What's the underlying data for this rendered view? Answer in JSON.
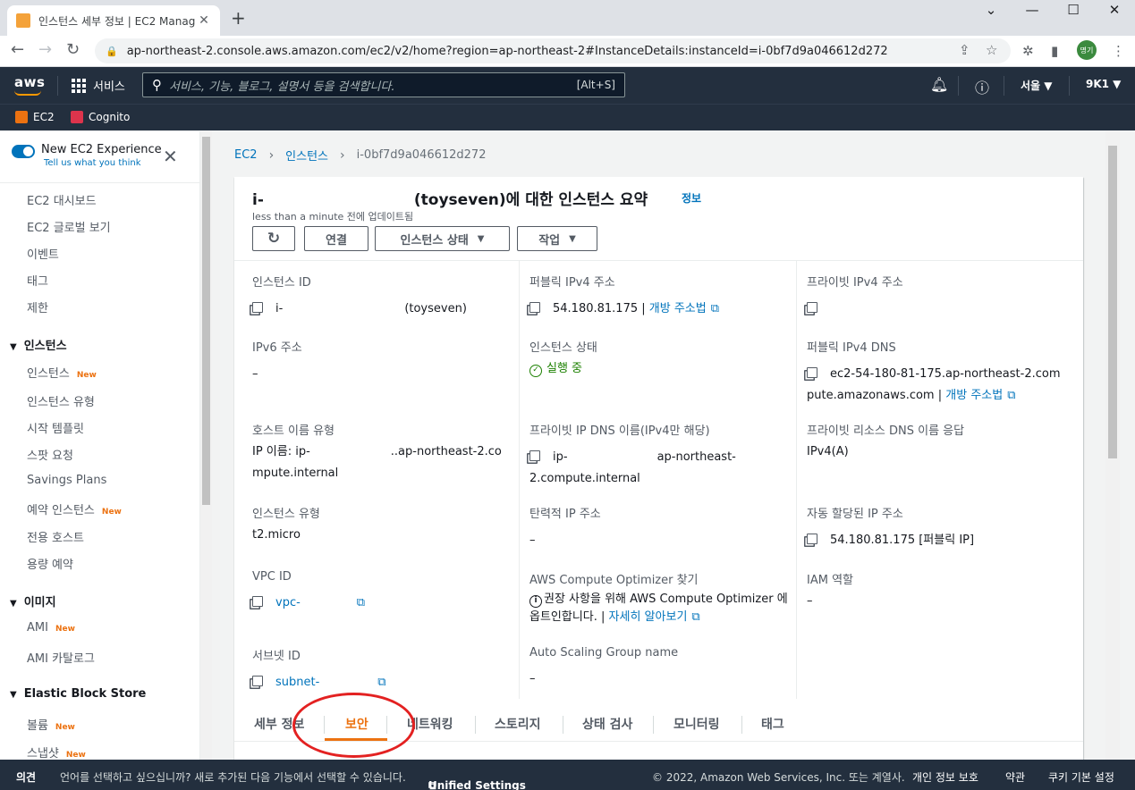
{
  "browser": {
    "tab_title": "인스턴스 세부 정보 | EC2 Manag",
    "url": "ap-northeast-2.console.aws.amazon.com/ec2/v2/home?region=ap-northeast-2#InstanceDetails:instanceId=i-0bf7d9a046612d272",
    "profile_initials": "명기"
  },
  "header": {
    "logo": "aws",
    "services_label": "서비스",
    "search_placeholder": "서비스, 기능, 블로그, 설명서 등을 검색합니다.",
    "search_shortcut": "[Alt+S]",
    "region": "서울 ▼",
    "account": "9K1 ▼"
  },
  "favorites": [
    {
      "label": "EC2",
      "color": "#ec7211"
    },
    {
      "label": "Cognito",
      "color": "#dd344c"
    }
  ],
  "sidebar": {
    "new_experience": "New EC2 Experience",
    "feedback": "Tell us what you think",
    "top_items": [
      "EC2 대시보드",
      "EC2 글로벌 보기",
      "이벤트",
      "태그",
      "제한"
    ],
    "sections": {
      "instances": "인스턴스",
      "images": "이미지",
      "ebs": "Elastic Block Store"
    },
    "instance_items": [
      "인스턴스",
      "인스턴스 유형",
      "시작 템플릿",
      "스팟 요청",
      "Savings Plans",
      "예약 인스턴스",
      "전용 호스트",
      "용량 예약"
    ],
    "image_items": [
      "AMI",
      "AMI 카탈로그"
    ],
    "ebs_items": [
      "볼륨",
      "스냅샷"
    ],
    "new_badge": "New"
  },
  "breadcrumb": [
    "EC2",
    "인스턴스",
    "i-0bf7d9a046612d272"
  ],
  "summary": {
    "title_prefix": "i-",
    "title_suffix": "(toyseven)에 대한 인스턴스 요약",
    "info": "정보",
    "updated": "less than a minute 전에 업데이트됨",
    "buttons": {
      "connect": "연결",
      "state": "인스턴스 상태",
      "actions": "작업"
    }
  },
  "details": {
    "instance_id_label": "인스턴스 ID",
    "instance_id_value": "i-",
    "instance_id_name": "(toyseven)",
    "public_ipv4_label": "퍼블릭 IPv4 주소",
    "public_ipv4_value": "54.180.81.175 |",
    "open_address": "개방 주소법",
    "private_ipv4_label": "프라이빗 IPv4 주소",
    "ipv6_label": "IPv6 주소",
    "ipv6_value": "–",
    "state_label": "인스턴스 상태",
    "state_value": "실행 중",
    "public_dns_label": "퍼블릭 IPv4 DNS",
    "public_dns_value": "ec2-54-180-81-175.ap-northeast-2.compute.amazonaws.com |",
    "hostname_type_label": "호스트 이름 유형",
    "hostname_type_value_a": "IP 이름: ip-",
    "hostname_type_value_b": "..ap-northeast-2.compute.internal",
    "private_dns_label": "프라이빗 IP DNS 이름(IPv4만 해당)",
    "private_dns_value_a": "ip-",
    "private_dns_value_b": "ap-northeast-2.compute.internal",
    "resource_dns_label": "프라이빗 리소스 DNS 이름 응답",
    "resource_dns_value": "IPv4(A)",
    "instance_type_label": "인스턴스 유형",
    "instance_type_value": "t2.micro",
    "elastic_ip_label": "탄력적 IP 주소",
    "elastic_ip_value": "–",
    "auto_ip_label": "자동 할당된 IP 주소",
    "auto_ip_value": "54.180.81.175 [퍼블릭 IP]",
    "vpc_label": "VPC ID",
    "vpc_value": "vpc-",
    "optimizer_label": "AWS Compute Optimizer 찾기",
    "optimizer_value": "권장 사항을 위해 AWS Compute Optimizer 에 옵트인합니다. |",
    "learn_more": "자세히 알아보기",
    "iam_label": "IAM 역할",
    "iam_value": "–",
    "subnet_label": "서브넷 ID",
    "subnet_value": "subnet-",
    "asg_label": "Auto Scaling Group name",
    "asg_value": "–"
  },
  "tabs": [
    "세부 정보",
    "보안",
    "네트워킹",
    "스토리지",
    "상태 검사",
    "모니터링",
    "태그"
  ],
  "active_tab": "보안",
  "footer": {
    "feedback": "의견",
    "language_note": "언어를 선택하고 싶으십니까? 새로 추가된 다음 기능에서 선택할 수 있습니다.",
    "unified": "Unified Settings",
    "copyright": "© 2022, Amazon Web Services, Inc. 또는 계열사.",
    "privacy": "개인 정보 보호",
    "terms": "약관",
    "cookies": "쿠키 기본 설정"
  }
}
